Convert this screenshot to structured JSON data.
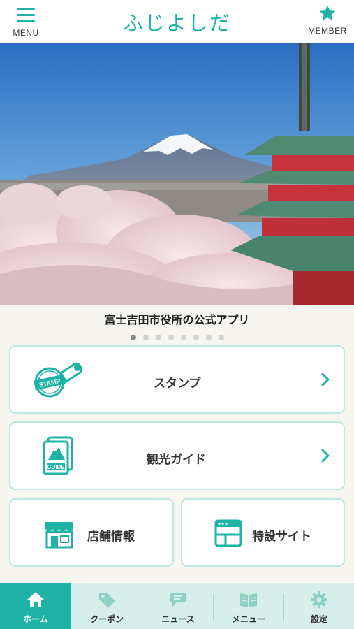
{
  "header": {
    "menu_label": "MENU",
    "logo_text": "ふじよしだ",
    "member_label": "MEMBER"
  },
  "hero": {
    "caption": "富士吉田市役所の公式アプリ",
    "slide_count": 8,
    "active_slide": 1
  },
  "cards": {
    "stamp": "スタンプ",
    "guide": "観光ガイド",
    "shops": "店舗情報",
    "special": "特設サイト",
    "stamp_icon_text": "STAMP",
    "guide_icon_text": "GUIDE"
  },
  "tabs": [
    {
      "label": "ホーム",
      "icon": "home-icon"
    },
    {
      "label": "クーポン",
      "icon": "tag-icon"
    },
    {
      "label": "ニュース",
      "icon": "chat-icon"
    },
    {
      "label": "メニュー",
      "icon": "book-icon"
    },
    {
      "label": "設定",
      "icon": "gear-icon"
    }
  ],
  "colors": {
    "accent": "#1fb3a5",
    "tabbar": "#d7efeb",
    "card_border": "#bde6de"
  }
}
